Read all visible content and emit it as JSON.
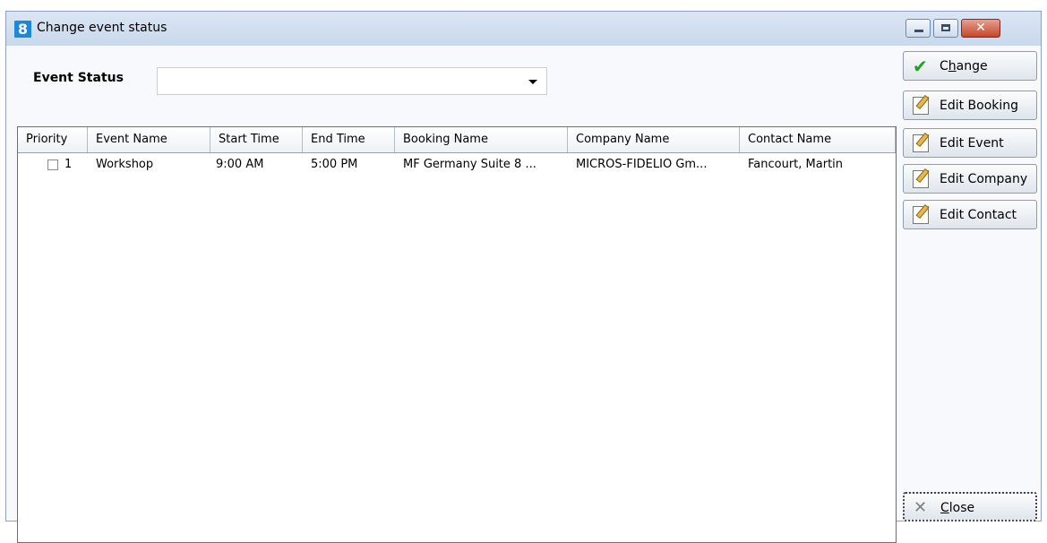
{
  "window": {
    "title": "Change event status",
    "app_icon_glyph": "8"
  },
  "form": {
    "event_status_label": "Event Status",
    "event_status_value": ""
  },
  "table": {
    "columns": [
      "Priority",
      "Event Name",
      "Start Time",
      "End Time",
      "Booking Name",
      "Company Name",
      "Contact Name"
    ],
    "rows": [
      {
        "checked": false,
        "priority": "1",
        "event_name": "Workshop",
        "start_time": "9:00 AM",
        "end_time": "5:00 PM",
        "booking_name": "MF Germany Suite 8 ...",
        "company_name": "MICROS-FIDELIO Gm...",
        "contact_name": "Fancourt, Martin"
      }
    ]
  },
  "buttons": {
    "change_prefix": "C",
    "change_underline": "h",
    "change_suffix": "ange",
    "edit_booking": "Edit Booking",
    "edit_event": "Edit Event",
    "edit_company": "Edit Company",
    "edit_contact": "Edit Contact",
    "close_underline": "C",
    "close_suffix": "lose"
  },
  "icons": {
    "change": "check-icon",
    "edit": "edit-icon",
    "close": "close-icon"
  },
  "colors": {
    "accent_check": "#1ea21a",
    "titlebar": "#c9d8ec",
    "close_button": "#c4472c"
  }
}
